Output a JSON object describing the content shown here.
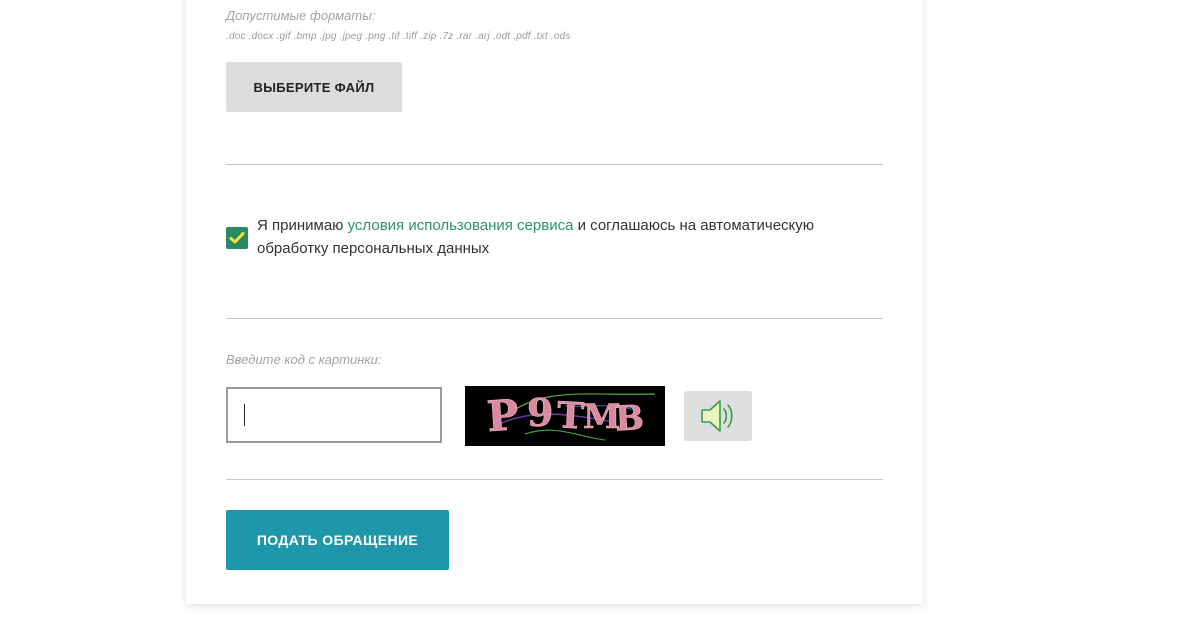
{
  "upload": {
    "formats_label": "Допустимые форматы:",
    "formats_list": ".doc .docx .gif .bmp .jpg .jpeg .png .tif .tiff .zip .7z .rar .arj .odt .pdf .txt .ods",
    "choose_file_label": "ВЫБЕРИТЕ ФАЙЛ"
  },
  "consent": {
    "checked": true,
    "text_before": "Я принимаю ",
    "link_text": "условия использования сервиса",
    "text_after": " и соглашаюсь на автоматическую обработку персональных данных",
    "link_color": "#2c9563",
    "checkbox_color": "#2a8a62"
  },
  "captcha": {
    "label": "Введите код с картинки:",
    "input_value": "",
    "image_text": "P9TMB",
    "audio_icon": "speaker-icon"
  },
  "submit": {
    "label": "ПОДАТЬ ОБРАЩЕНИЕ",
    "color": "#1e97ab"
  }
}
